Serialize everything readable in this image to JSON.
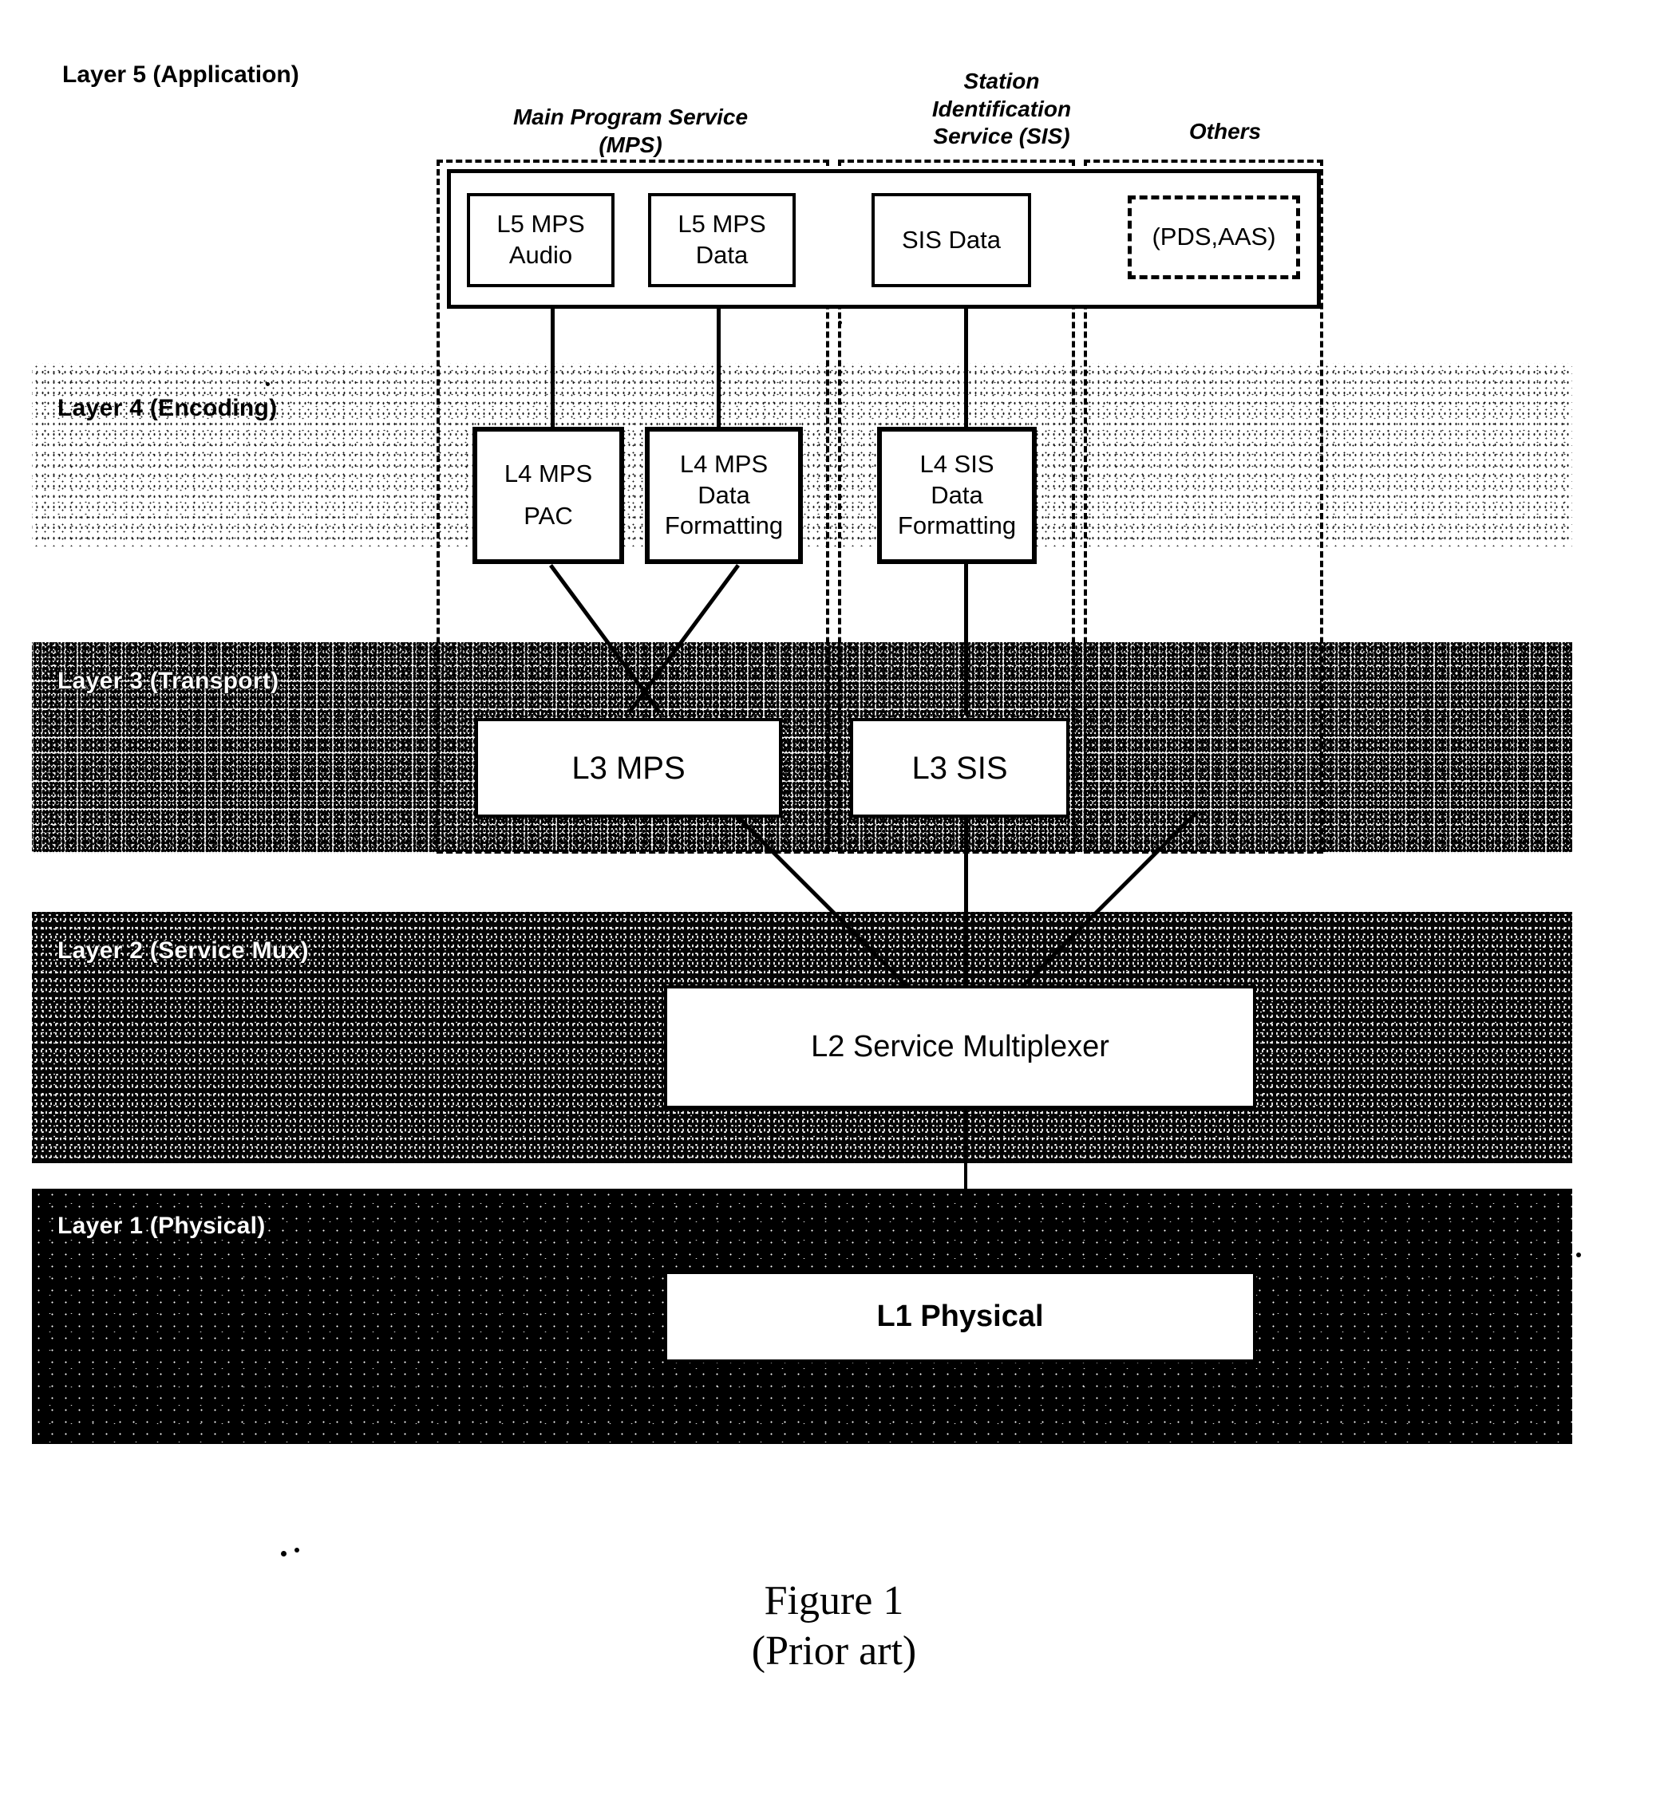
{
  "figure": {
    "caption_line1": "Figure 1",
    "caption_line2": "(Prior art)"
  },
  "layers": [
    {
      "id": "layer5",
      "label": "Layer 5 (Application)",
      "tone": "white"
    },
    {
      "id": "layer4",
      "label": "Layer 4 (Encoding)",
      "tone": "light-speckle"
    },
    {
      "id": "layer3",
      "label": "Layer 3 (Transport)",
      "tone": "mid-speckle"
    },
    {
      "id": "layer2",
      "label": "Layer 2 (Service Mux)",
      "tone": "dark-speckle"
    },
    {
      "id": "layer1",
      "label": "Layer 1 (Physical)",
      "tone": "darkest-speckle"
    }
  ],
  "service_columns": [
    {
      "id": "mps",
      "header": "Main Program Service\n(MPS)"
    },
    {
      "id": "sis",
      "header": "Station\nIdentification\nService (SIS)"
    },
    {
      "id": "others",
      "header": "Others"
    }
  ],
  "nodes": {
    "l5_mps_audio": {
      "line1": "L5 MPS",
      "line2": "Audio"
    },
    "l5_mps_data": {
      "line1": "L5 MPS",
      "line2": "Data"
    },
    "l5_sis_data": {
      "line1": "SIS Data",
      "line2": ""
    },
    "l5_others": {
      "line1": "(PDS,AAS)",
      "line2": ""
    },
    "l4_mps_pac": {
      "line1": "L4 MPS",
      "line2": "PAC"
    },
    "l4_mps_data_formatting": {
      "line1": "L4 MPS",
      "line2": "Data",
      "line3": "Formatting"
    },
    "l4_sis_data_formatting": {
      "line1": "L4 SIS",
      "line2": "Data",
      "line3": "Formatting"
    },
    "l3_mps": {
      "line1": "L3 MPS"
    },
    "l3_sis": {
      "line1": "L3 SIS"
    },
    "l2_service_multiplexer": {
      "line1": "L2 Service Multiplexer"
    },
    "l1_physical": {
      "line1": "L1 Physical"
    }
  },
  "colors": {
    "ink": "#000000",
    "paper": "#ffffff",
    "band_light": "#e9e9e9",
    "band_mid": "#8a8a8a",
    "band_dark": "#2a2a2a",
    "band_darkest": "#0a0a0a"
  }
}
